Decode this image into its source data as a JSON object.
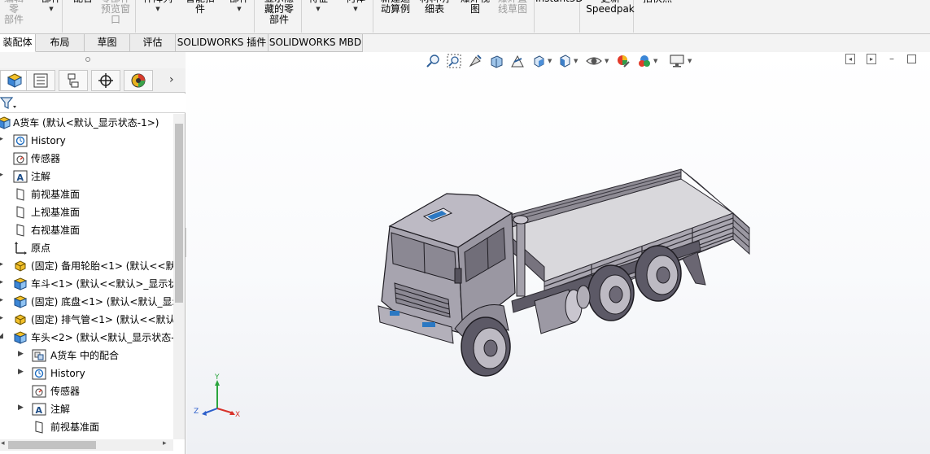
{
  "ribbon": {
    "items": [
      {
        "label": "编辑零\n部件",
        "gray": true
      },
      {
        "label": "部件",
        "gray": false
      },
      {
        "label": "配合",
        "gray": false
      },
      {
        "label": "零部件\n预览窗\n口",
        "gray": true
      },
      {
        "label": "件阵列",
        "gray": false
      },
      {
        "label": "智能扣\n件",
        "gray": false
      },
      {
        "label": "部件",
        "gray": false
      },
      {
        "label": "显示隐\n藏的零\n部件",
        "gray": false
      },
      {
        "label": "特征",
        "gray": false
      },
      {
        "label": "何体",
        "gray": false
      },
      {
        "label": "新建运\n动算例",
        "gray": false
      },
      {
        "label": "材料明\n细表",
        "gray": false
      },
      {
        "label": "爆炸视\n图",
        "gray": false
      },
      {
        "label": "爆炸直\n线草图",
        "gray": true
      },
      {
        "label": "Instant3D",
        "gray": false
      },
      {
        "label": "更新\nSpeedpak",
        "gray": false
      },
      {
        "label": "拍快照",
        "gray": false
      }
    ]
  },
  "tabs": [
    {
      "label": "装配体"
    },
    {
      "label": "布局"
    },
    {
      "label": "草图"
    },
    {
      "label": "评估"
    },
    {
      "label": "SOLIDWORKS 插件"
    },
    {
      "label": "SOLIDWORKS MBD"
    }
  ],
  "tree": {
    "root": "A货车  (默认<默认_显示状态-1>)",
    "items": [
      {
        "label": "History",
        "icon": "history-icon",
        "level": 0,
        "expander": true
      },
      {
        "label": "传感器",
        "icon": "sensor-icon",
        "level": 0,
        "expander": false
      },
      {
        "label": "注解",
        "icon": "annotation-icon",
        "level": 0,
        "expander": true
      },
      {
        "label": "前视基准面",
        "icon": "plane-icon",
        "level": 0,
        "expander": false
      },
      {
        "label": "上视基准面",
        "icon": "plane-icon",
        "level": 0,
        "expander": false
      },
      {
        "label": "右视基准面",
        "icon": "plane-icon",
        "level": 0,
        "expander": false
      },
      {
        "label": "原点",
        "icon": "origin-icon",
        "level": 0,
        "expander": false
      },
      {
        "label": "(固定) 备用轮胎<1> (默认<<默认",
        "icon": "part-icon",
        "level": 0,
        "expander": true
      },
      {
        "label": "车斗<1> (默认<<默认>_显示状",
        "icon": "assembly-icon",
        "level": 0,
        "expander": true
      },
      {
        "label": "(固定) 底盘<1> (默认<默认_显示",
        "icon": "assembly-icon",
        "level": 0,
        "expander": true
      },
      {
        "label": "(固定) 排气管<1> (默认<<默认",
        "icon": "part-icon",
        "level": 0,
        "expander": true
      },
      {
        "label": "车头<2> (默认<默认_显示状态-",
        "icon": "assembly-icon",
        "level": 0,
        "expander": true,
        "expanded": true
      },
      {
        "label": "A货车 中的配合",
        "icon": "mates-icon",
        "level": 1,
        "expander": true
      },
      {
        "label": "History",
        "icon": "history-icon",
        "level": 1,
        "expander": true
      },
      {
        "label": "传感器",
        "icon": "sensor-icon",
        "level": 1,
        "expander": false
      },
      {
        "label": "注解",
        "icon": "annotation-icon",
        "level": 1,
        "expander": true
      },
      {
        "label": "前视基准面",
        "icon": "plane-icon",
        "level": 1,
        "expander": false
      }
    ]
  },
  "triad": {
    "x": "X",
    "y": "Y",
    "z": "Z"
  },
  "colors": {
    "accent": "#1a73c8",
    "truck": "#b1adb6",
    "truck_dark": "#4a4752"
  }
}
